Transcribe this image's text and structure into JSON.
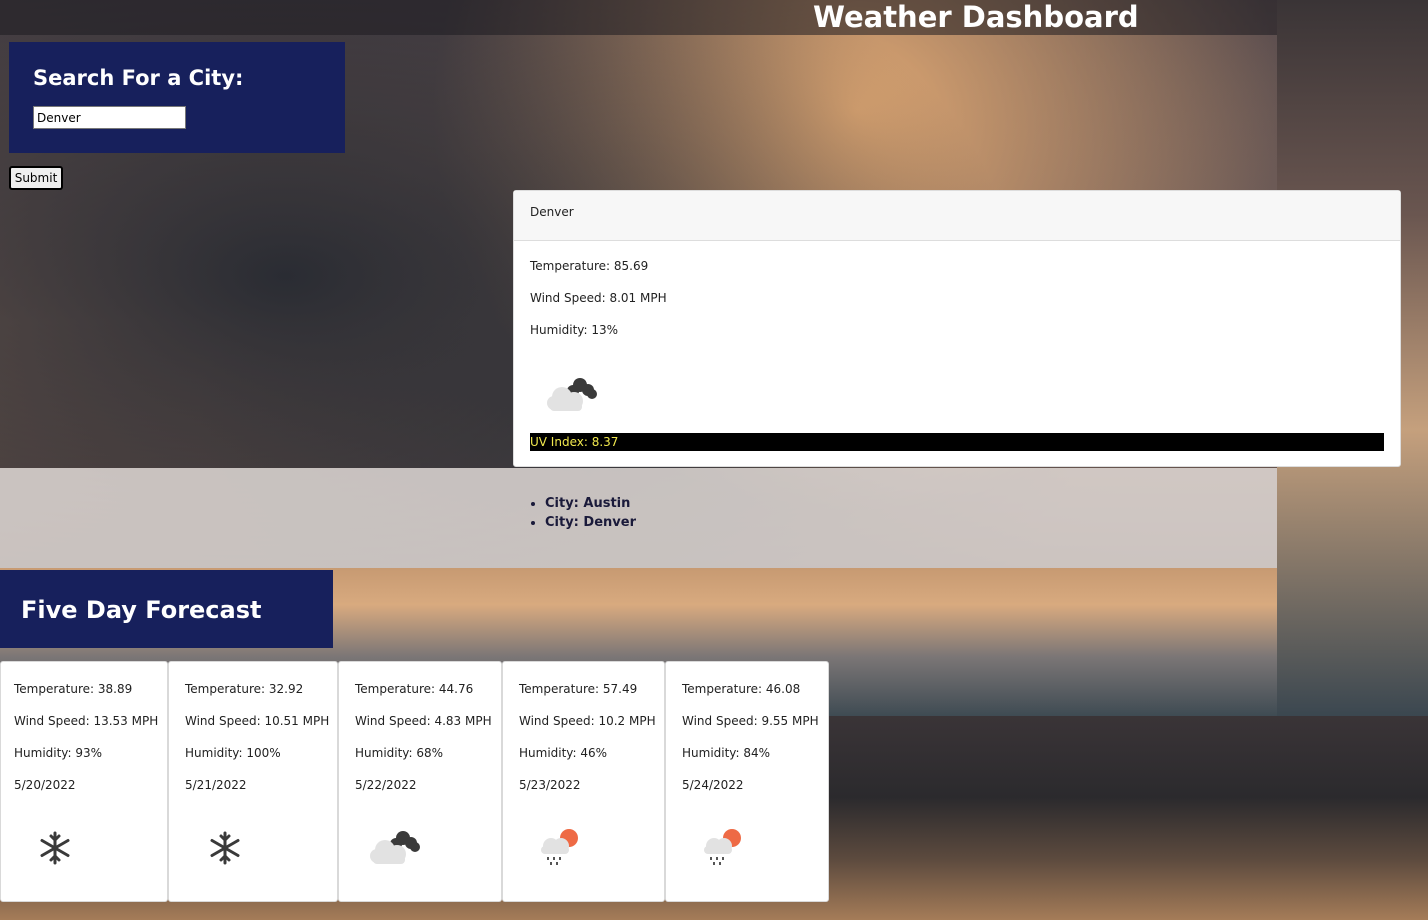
{
  "header": {
    "title": "Weather Dashboard"
  },
  "search": {
    "heading": "Search For a City:",
    "input_value": "Denver",
    "submit_label": "Submit"
  },
  "current": {
    "city": "Denver",
    "temperature": "Temperature: 85.69",
    "wind": "Wind Speed: 8.01 MPH",
    "humidity": "Humidity: 13%",
    "icon": "cloudy-icon",
    "uv": "UV Index: 8.37",
    "uv_color": "#f2e94e"
  },
  "history": {
    "items": [
      "City: Austin",
      "City: Denver"
    ]
  },
  "forecast": {
    "title": "Five Day Forecast",
    "days": [
      {
        "temperature": "Temperature: 38.89",
        "wind": "Wind Speed: 13.53 MPH",
        "humidity": "Humidity: 93%",
        "date": "5/20/2022",
        "icon": "snowflake-icon"
      },
      {
        "temperature": "Temperature: 32.92",
        "wind": "Wind Speed: 10.51 MPH",
        "humidity": "Humidity: 100%",
        "date": "5/21/2022",
        "icon": "snowflake-icon"
      },
      {
        "temperature": "Temperature: 44.76",
        "wind": "Wind Speed: 4.83 MPH",
        "humidity": "Humidity: 68%",
        "date": "5/22/2022",
        "icon": "cloudy-icon"
      },
      {
        "temperature": "Temperature: 57.49",
        "wind": "Wind Speed: 10.2 MPH",
        "humidity": "Humidity: 46%",
        "date": "5/23/2022",
        "icon": "sun-rain-icon"
      },
      {
        "temperature": "Temperature: 46.08",
        "wind": "Wind Speed: 9.55 MPH",
        "humidity": "Humidity: 84%",
        "date": "5/24/2022",
        "icon": "sun-rain-icon"
      }
    ]
  },
  "colors": {
    "panel": "#17205c",
    "uv_bg": "#000000"
  }
}
